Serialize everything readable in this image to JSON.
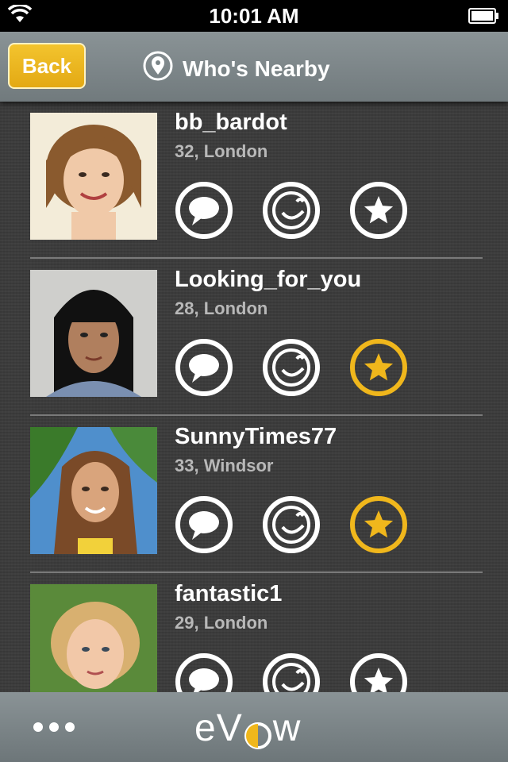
{
  "status_bar": {
    "time": "10:01 AM"
  },
  "nav": {
    "back_label": "Back",
    "title": "Who's Nearby"
  },
  "colors": {
    "accent": "#f0b71c",
    "background": "#3a3a3a",
    "navbar": "#7b8588"
  },
  "profiles": [
    {
      "name": "bb_bardot",
      "meta": "32, London",
      "favorited": false
    },
    {
      "name": "Looking_for_you",
      "meta": "28, London",
      "favorited": true
    },
    {
      "name": "SunnyTimes77",
      "meta": "33, Windsor",
      "favorited": true
    },
    {
      "name": "fantastic1",
      "meta": "29, London",
      "favorited": false
    }
  ],
  "icons": [
    "wifi-icon",
    "battery-icon",
    "location-pin-icon",
    "chat-icon",
    "wink-icon",
    "star-icon",
    "more-icon"
  ],
  "footer": {
    "logo_left": "eV",
    "logo_right": "w"
  }
}
